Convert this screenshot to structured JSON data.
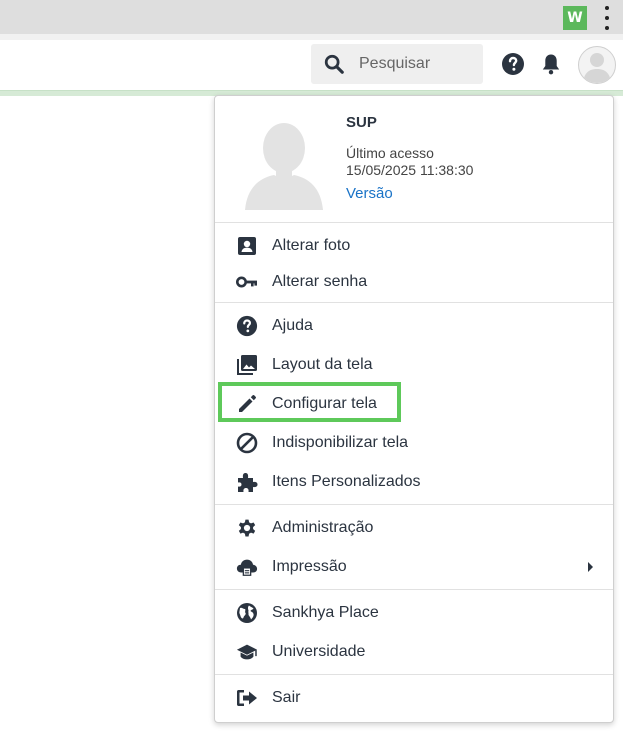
{
  "browser": {
    "extension_label": "W",
    "extension_color": "#5cb85c"
  },
  "header": {
    "search": {
      "placeholder": "Pesquisar",
      "value": ""
    },
    "icons": [
      "help-icon",
      "bell-icon",
      "avatar"
    ]
  },
  "user_menu": {
    "user_name": "SUP",
    "last_access_label": "Último acesso",
    "last_access_date": "15/05/2025 11:38:30",
    "version_link": "Versão",
    "groups": [
      [
        {
          "label": "Alterar foto",
          "icon": "contact-card-icon"
        },
        {
          "label": "Alterar senha",
          "icon": "key-icon"
        }
      ],
      [
        {
          "label": "Ajuda",
          "icon": "help-circle-icon"
        },
        {
          "label": "Layout da tela",
          "icon": "image-stack-icon"
        },
        {
          "label": "Configurar tela",
          "icon": "pencil-icon",
          "highlighted": true
        },
        {
          "label": "Indisponibilizar tela",
          "icon": "block-icon"
        },
        {
          "label": "Itens Personalizados",
          "icon": "puzzle-icon"
        }
      ],
      [
        {
          "label": "Administração",
          "icon": "gear-icon"
        },
        {
          "label": "Impressão",
          "icon": "cloud-print-icon",
          "has_submenu": true
        }
      ],
      [
        {
          "label": "Sankhya Place",
          "icon": "globe-icon"
        },
        {
          "label": "Universidade",
          "icon": "graduation-cap-icon"
        }
      ],
      [
        {
          "label": "Sair",
          "icon": "sign-out-icon"
        }
      ]
    ]
  },
  "colors": {
    "icon": "#2b3440",
    "link": "#1a73c7",
    "highlight": "#5ec95a"
  }
}
